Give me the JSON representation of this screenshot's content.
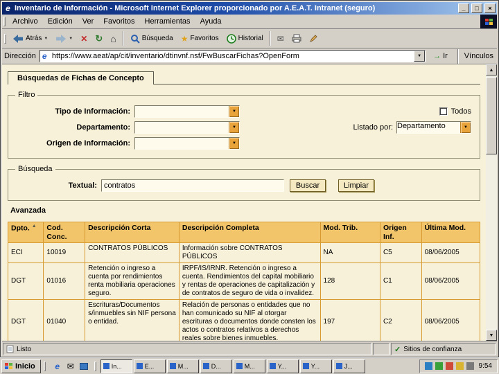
{
  "window": {
    "title": "Inventario de Información - Microsoft Internet Explorer proporcionado por A.E.A.T.  Intranet (seguro)"
  },
  "menubar": {
    "items": [
      "Archivo",
      "Edición",
      "Ver",
      "Favoritos",
      "Herramientas",
      "Ayuda"
    ]
  },
  "toolbar": {
    "back_label": "Atrás",
    "search_label": "Búsqueda",
    "favorites_label": "Favoritos",
    "history_label": "Historial"
  },
  "addressbar": {
    "label": "Dirección",
    "url": "https://www.aeat/ap/cit/inventario/dtinvnf.nsf/FwBuscarFichas?OpenForm",
    "go_label": "Ir",
    "links_label": "Vínculos"
  },
  "page": {
    "tab_title": "Búsquedas de Fichas de Concepto",
    "filtro": {
      "legend": "Filtro",
      "fields": [
        {
          "label": "Tipo de Información:"
        },
        {
          "label": "Departamento:"
        },
        {
          "label": "Origen de Información:"
        }
      ],
      "todos_label": "Todos",
      "listado_label": "Listado por:",
      "listado_value": "Departamento"
    },
    "busqueda": {
      "legend": "Búsqueda",
      "textual_label": "Textual:",
      "textual_value": "contratos",
      "buscar_label": "Buscar",
      "limpiar_label": "Limpiar"
    },
    "avanzada_label": "Avanzada",
    "table": {
      "headers": [
        "Dpto.",
        "Cod. Conc.",
        "Descripción Corta",
        "Descripción Completa",
        "Mod. Trib.",
        "Origen Inf.",
        "Última Mod."
      ],
      "rows": [
        [
          "ECI",
          "10019",
          "CONTRATOS PÚBLICOS",
          "Información sobre CONTRATOS PÚBLICOS",
          "NA",
          "C5",
          "08/06/2005"
        ],
        [
          "DGT",
          "01016",
          "Retención o ingreso a cuenta por rendimientos renta mobiliaria operaciones seguro.",
          "IRPF/IS/IRNR. Retención o ingreso a cuenta. Rendimientos del capital mobiliario y rentas de operaciones de capitalización y de contratos de seguro de vida o invalidez.",
          "128",
          "C1",
          "08/06/2005"
        ],
        [
          "DGT",
          "01040",
          "Escrituras/Documentos s/inmuebles sin NIF persona o entidad.",
          "Relación de personas o entidades que no han comunicado su NIF al otorgar escrituras o documentos donde consten los actos o contratos relativos a derechos reales sobre bienes inmuebles.",
          "197",
          "C2",
          "08/06/2005"
        ]
      ]
    }
  },
  "statusbar": {
    "status": "Listo",
    "zone": "Sitios de confianza"
  },
  "taskbar": {
    "start_label": "Inicio",
    "tasks": [
      {
        "label": "In..."
      },
      {
        "label": "E..."
      },
      {
        "label": "M..."
      },
      {
        "label": "D..."
      },
      {
        "label": "M..."
      },
      {
        "label": "Y..."
      },
      {
        "label": "Y..."
      },
      {
        "label": "J..."
      }
    ],
    "time": "9:54"
  },
  "icons": {
    "ie": "e",
    "minimize": "_",
    "maximize": "□",
    "close": "×",
    "drop": "▼",
    "stop": "✕",
    "refresh": "↻",
    "home": "⌂",
    "favorites": "★",
    "mail": "✉",
    "combo_arrow": "▼",
    "go_arrow": "→",
    "links_chevron": "»",
    "check": "✓",
    "scroll_up": "▲",
    "scroll_down": "▼",
    "sort": "▲"
  },
  "colors": {
    "titlebar_start": "#0a246a",
    "titlebar_end": "#a6caf0",
    "page_bg": "#f7f1d9",
    "table_header_bg": "#f3c56b",
    "table_border": "#d69a30",
    "accent_orange": "#e9a33b",
    "chrome_gray": "#d4d0c8"
  }
}
